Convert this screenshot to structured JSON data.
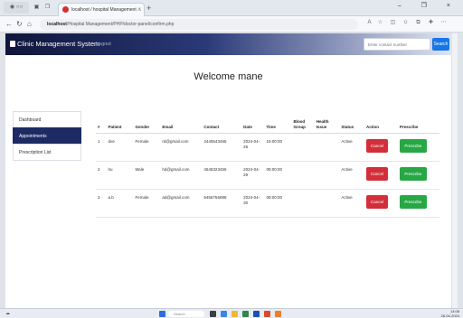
{
  "browser": {
    "tab_title": "localhost / hospital Management ...",
    "tab_close": "×",
    "new_tab": "+",
    "window_buttons": "– ❐ ×",
    "url_host": "localhost",
    "url_path": "/Hospital Management/PHP/doctor-panel/confirm.php"
  },
  "app": {
    "brand": "Clinic Management System",
    "logout": "Logout",
    "search_placeholder": "Enter contact number",
    "search_button": "Search",
    "welcome": "Welcome  mane"
  },
  "sidebar": {
    "items": [
      {
        "label": "Dashboard"
      },
      {
        "label": "Appointments"
      },
      {
        "label": "Prescription List"
      }
    ]
  },
  "table": {
    "headers": [
      "#",
      "Patient",
      "Gender",
      "Email",
      "Contact",
      "Date",
      "Time",
      "Blood Group",
      "Health Issue",
      "Status",
      "Action",
      "Prescribe"
    ],
    "rows": [
      {
        "id": "1",
        "patient": "dve",
        "gender": "Female",
        "email": "rd@gmail.com",
        "contact": "3445543465",
        "date": "2024-04-26",
        "time": "16:00:00",
        "blood": "",
        "issue": "",
        "status": "Active",
        "action": "Cancel",
        "prescribe": "Prescribe"
      },
      {
        "id": "2",
        "patient": "hu",
        "gender": "Male",
        "email": "hd@gmail.com",
        "contact": "4545323456",
        "date": "2024-04-29",
        "time": "08:00:00",
        "blood": "",
        "issue": "",
        "status": "Active",
        "action": "Cancel",
        "prescribe": "Prescribe"
      },
      {
        "id": "3",
        "patient": "a.b",
        "gender": "Female",
        "email": "ad@gmail.com",
        "contact": "9456756888",
        "date": "2024-04-30",
        "time": "08:00:00",
        "blood": "",
        "issue": "",
        "status": "Active",
        "action": "Cancel",
        "prescribe": "Prescribe"
      }
    ]
  },
  "taskbar": {
    "search": "Search",
    "time": "14:08",
    "date": "26-04-2024"
  },
  "colors": {
    "navbar_dark": "#10163a",
    "sidebar_active": "#1d2a63",
    "cancel": "#d32f3a",
    "prescribe": "#28a745",
    "search_button": "#1677e6"
  }
}
